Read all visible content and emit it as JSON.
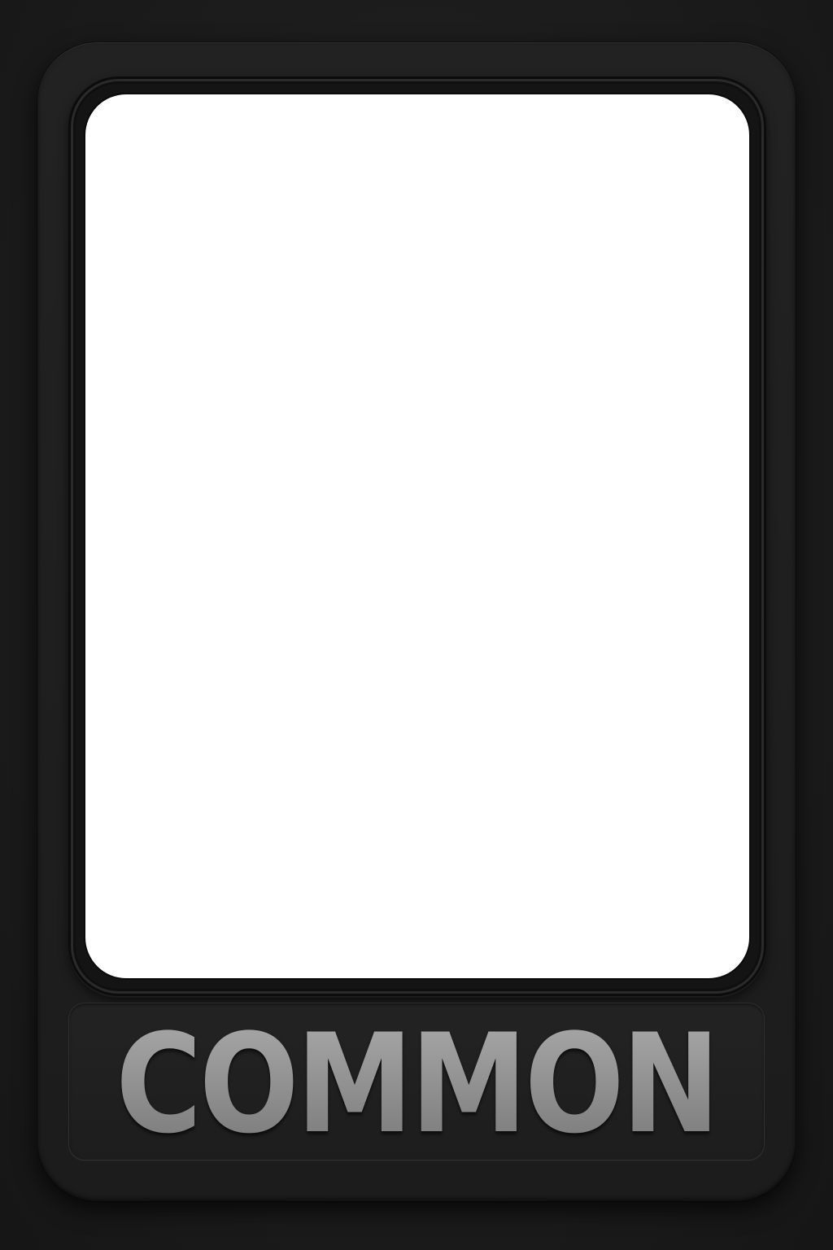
{
  "card": {
    "rarity_label": "COMMON"
  },
  "colors": {
    "background": "#1b1b1b",
    "frame": "#1f1f1f",
    "art_window": "#ffffff",
    "rarity_text": "#9b9b9b"
  }
}
